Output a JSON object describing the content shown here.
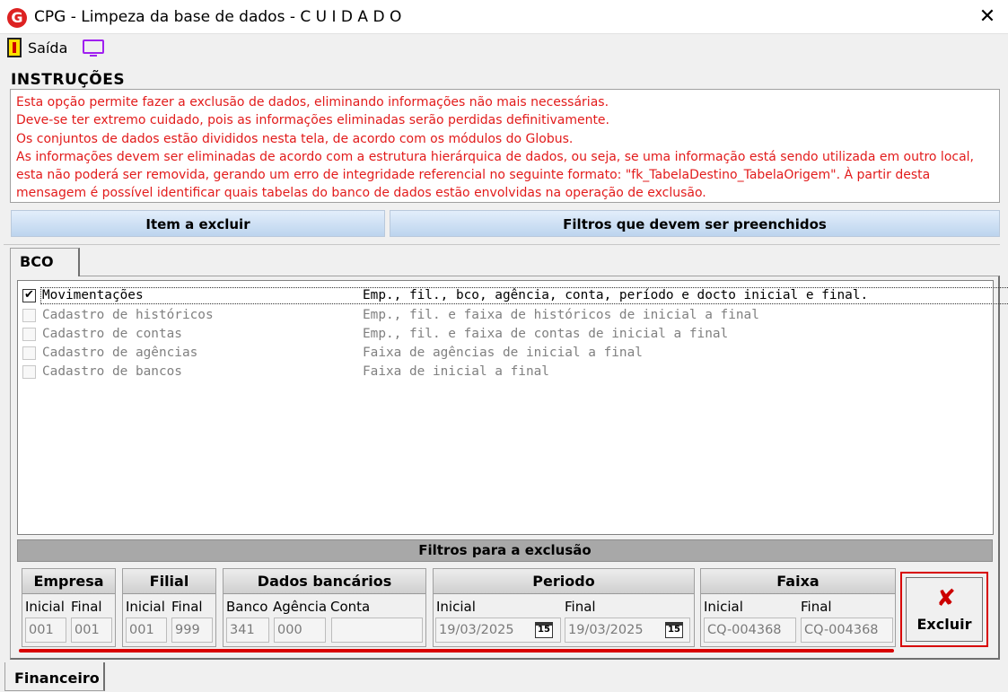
{
  "window": {
    "logo_letter": "G",
    "title": "CPG - Limpeza da base de dados - C U I D A D O",
    "close_glyph": "✕"
  },
  "toolbar": {
    "exit_label": "Saída",
    "exit_icon": "exit-door-icon",
    "monitor_icon": "monitor-icon"
  },
  "instructions": {
    "title": "INSTRUÇÕES",
    "lines": [
      "Esta opção permite fazer a exclusão de dados, eliminando informações não mais necessárias.",
      "Deve-se ter extremo cuidado, pois as informações eliminadas serão perdidas definitivamente.",
      "Os conjuntos de dados estão divididos nesta tela, de acordo com os módulos do Globus.",
      "As informações devem ser eliminadas de acordo com a estrutura hierárquica de dados, ou seja, se uma informação está sendo utilizada em outro local,",
      "esta não poderá ser removida, gerando um erro de integridade referencial no seguinte formato: \"fk_TabelaDestino_TabelaOrigem\". À partir desta",
      "mensagem é possível identificar quais tabelas do banco de dados estão envolvidas na operação de exclusão."
    ],
    "color": "#e21b1b"
  },
  "headers": {
    "item": "Item a excluir",
    "filters": "Filtros que devem ser preenchidos"
  },
  "tab": {
    "label": "BCO"
  },
  "items": [
    {
      "name": "Movimentações",
      "desc": "Emp., fil., bco, agência, conta, período e docto inicial e final.",
      "checked": true
    },
    {
      "name": "Cadastro de históricos",
      "desc": "Emp., fil. e faixa de históricos de inicial a final",
      "checked": false
    },
    {
      "name": "Cadastro de contas",
      "desc": "Emp., fil. e faixa de contas de inicial a final",
      "checked": false
    },
    {
      "name": "Cadastro de agências",
      "desc": "Faixa de agências de inicial a final",
      "checked": false
    },
    {
      "name": "Cadastro de bancos",
      "desc": "Faixa de inicial a final",
      "checked": false
    }
  ],
  "filters": {
    "title": "Filtros para a exclusão",
    "empresa": {
      "title": "Empresa",
      "initial_label": "Inicial",
      "final_label": "Final",
      "initial": "001",
      "final": "001"
    },
    "filial": {
      "title": "Filial",
      "initial_label": "Inicial",
      "final_label": "Final",
      "initial": "001",
      "final": "999"
    },
    "banco": {
      "title": "Dados bancários",
      "bank_label": "Banco",
      "agency_label": "Agência",
      "account_label": "Conta",
      "bank": "341",
      "agency": "000"
    },
    "periodo": {
      "title": "Periodo",
      "initial_label": "Inicial",
      "final_label": "Final",
      "initial": "19/03/2025",
      "final": "19/03/2025",
      "calendar_day": "15"
    },
    "faixa": {
      "title": "Faixa",
      "initial_label": "Inicial",
      "final_label": "Final",
      "initial": "CQ-004368",
      "final": "CQ-004368"
    }
  },
  "actions": {
    "delete_label": "Excluir",
    "delete_glyph": "✘"
  },
  "bottom_tab": {
    "label": "Financeiro"
  }
}
